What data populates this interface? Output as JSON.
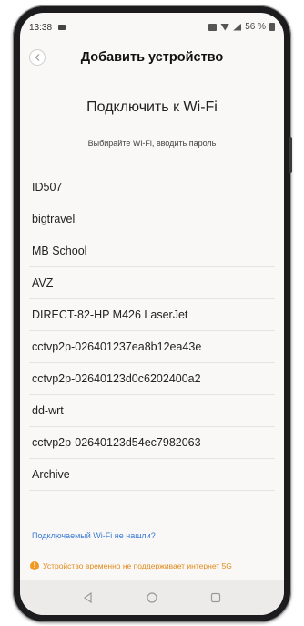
{
  "status_bar": {
    "time": "13:38",
    "battery": "56 %"
  },
  "header": {
    "title": "Добавить устройство"
  },
  "main": {
    "section_title": "Подключить к Wi-Fi",
    "subtitle": "Выбирайте Wi-Fi, вводить пароль",
    "wifi_networks": [
      "ID507",
      "bigtravel",
      "MB School",
      "AVZ",
      "DIRECT-82-HP M426 LaserJet",
      "cctvp2p-026401237ea8b12ea43e",
      "cctvp2p-02640123d0c6202400a2",
      "dd-wrt",
      "cctvp2p-02640123d54ec7982063",
      "Archive"
    ],
    "not_found_link": "Подключаемый Wi-Fi не нашли?",
    "notice": "Устройство временно не поддерживает интернет 5G",
    "notice_icon": "!"
  },
  "colors": {
    "link": "#3a7bd5",
    "warning": "#e08a1e"
  },
  "icons": {
    "back": "chevron-left-icon",
    "warning": "warning-icon",
    "nav": [
      "back-triangle-icon",
      "home-circle-icon",
      "recents-square-icon"
    ]
  }
}
